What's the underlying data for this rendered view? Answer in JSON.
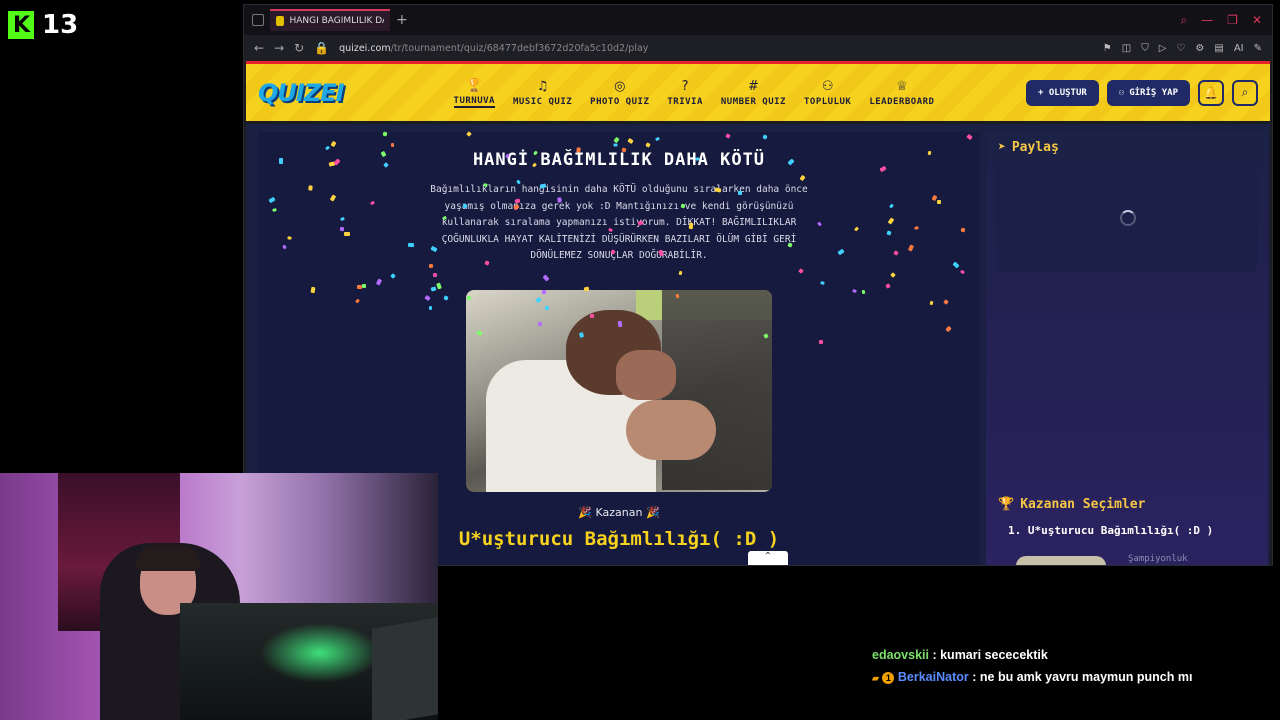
{
  "overlay": {
    "viewer_count": "13"
  },
  "browser": {
    "tab_title": "HANGİ BAĞIMLILIK DAHA",
    "url_domain": "quizei.com",
    "url_path": "/tr/tournament/quiz/68477debf3672d20fa5c10d2/play",
    "ai_label": "AI"
  },
  "site": {
    "logo": "QUIZEI",
    "nav": [
      {
        "label": "TURNUVA",
        "icon": "trophy-icon",
        "glyph": "🏆"
      },
      {
        "label": "MUSIC QUIZ",
        "icon": "music-icon",
        "glyph": "♫"
      },
      {
        "label": "PHOTO QUIZ",
        "icon": "camera-icon",
        "glyph": "◎"
      },
      {
        "label": "TRIVIA",
        "icon": "question-icon",
        "glyph": "?"
      },
      {
        "label": "NUMBER QUIZ",
        "icon": "hash-icon",
        "glyph": "#"
      },
      {
        "label": "TOPLULUK",
        "icon": "users-icon",
        "glyph": "⚇"
      },
      {
        "label": "LEADERBOARD",
        "icon": "medal-icon",
        "glyph": "♕"
      }
    ],
    "create_button": "+ OLUŞTUR",
    "login_button": "GİRİŞ YAP"
  },
  "quiz": {
    "title": "HANGİ BAĞIMLILIK DAHA KÖTÜ",
    "description": "Bağımlılıkların hangisinin daha KÖTÜ olduğunu sıralarken daha önce yaşamış olmanıza gerek yok :D Mantığınızı ve kendi görüşünüzü kullanarak sıralama yapmanızı istiyorum. DİKKAT! BAĞIMLILIKLAR ÇOĞUNLUKLA HAYAT KALİTENİZİ DÜŞÜRÜRKEN BAZILARI ÖLÜM GİBİ GERİ DÖNÜLEMEZ SONUÇLAR DOĞURABİLİR.",
    "winner_label": "🎉 Kazanan 🎉",
    "winner_name": "U*uşturucu Bağımlılığı( :D )"
  },
  "sidebar": {
    "share_title": "Paylaş",
    "winners_title": "Kazanan Seçimler",
    "winners_item": "1. U*uşturucu Bağımlılığı( :D )",
    "winners_sub": "Şampiyonluk"
  },
  "chat": {
    "messages": [
      {
        "user": "edaovskii",
        "text": ": kumari sececektik"
      },
      {
        "user": "BerkaiNator",
        "text": ": ne bu amk yavru maymun punch mı"
      }
    ]
  }
}
